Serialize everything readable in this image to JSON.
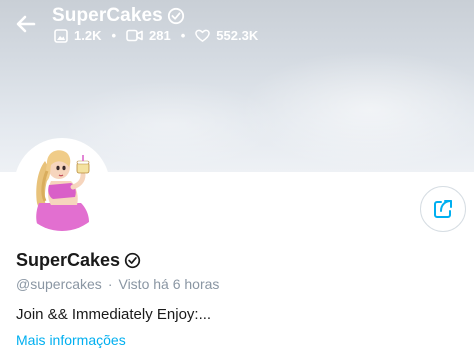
{
  "header": {
    "title": "SuperCakes",
    "stats": {
      "photos": "1.2K",
      "videos": "281",
      "likes": "552.3K"
    }
  },
  "profile": {
    "display_name": "SuperCakes",
    "handle": "@supercakes",
    "seen_label": "Visto",
    "seen_time": "há 6 horas",
    "bio": "Join && Immediately Enjoy:...",
    "more_link": "Mais informações"
  },
  "icons": {
    "back": "arrow-left-icon",
    "verified": "verified-badge-icon",
    "photo": "image-icon",
    "video": "video-icon",
    "like": "heart-icon",
    "share": "share-icon"
  },
  "colors": {
    "accent": "#00aff0",
    "muted_text": "#8a96a3",
    "text": "#1a1a1a"
  }
}
